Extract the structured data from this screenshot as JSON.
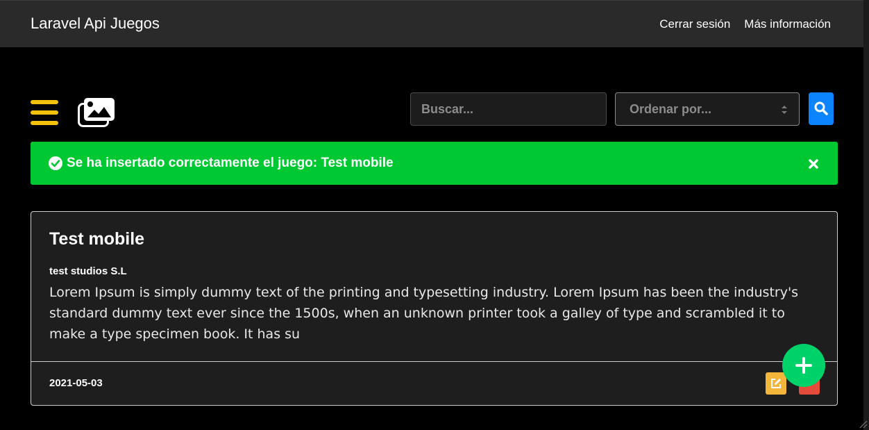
{
  "navbar": {
    "brand": "Laravel Api Juegos",
    "links": [
      "Cerrar sesión",
      "Más información"
    ]
  },
  "toolbar": {
    "search_placeholder": "Buscar...",
    "order_placeholder": "Ordenar por..."
  },
  "alert": {
    "message": "Se ha insertado correctamente el juego: Test mobile"
  },
  "card": {
    "title": "Test mobile",
    "studio": "test studios S.L",
    "description": "Lorem Ipsum is simply dummy text of the printing and typesetting industry. Lorem Ipsum has been the industry's standard dummy text ever since the 1500s, when an unknown printer took a galley of type and scrambled it to make a type specimen book. It has su",
    "date": "2021-05-03"
  },
  "colors": {
    "navbar_bg": "#2a2a2a",
    "menu_accent": "#f4c20d",
    "search_button": "#0d84ff",
    "alert_success": "#00c832",
    "edit_button": "#f4b63a",
    "delete_button": "#e44b3a",
    "fab": "#00d26a"
  },
  "icons": [
    "menu-icon",
    "gallery-icon",
    "search-icon",
    "check-circle-icon",
    "close-icon",
    "edit-icon",
    "delete-icon",
    "plus-icon"
  ]
}
